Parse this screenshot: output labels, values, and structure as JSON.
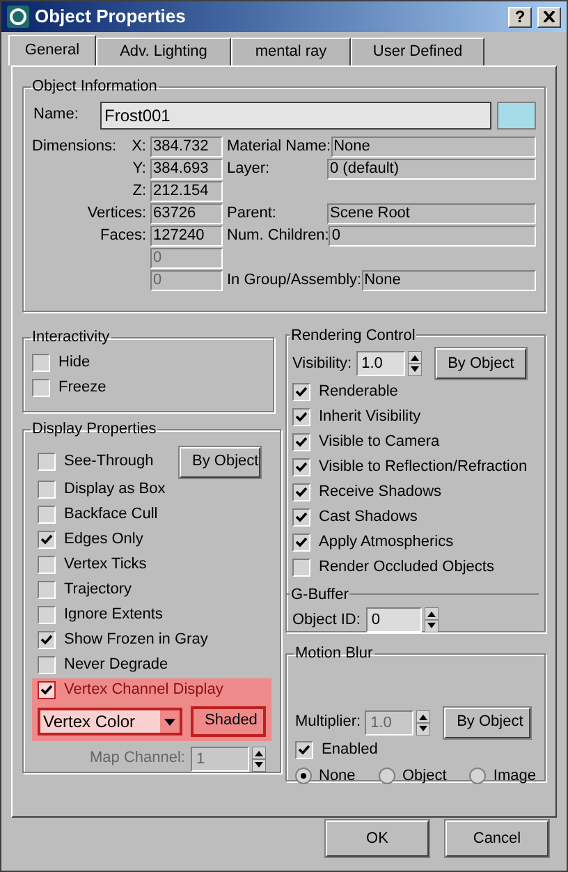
{
  "window": {
    "title": "Object Properties",
    "help_button": "?"
  },
  "tabs": [
    {
      "label": "General",
      "selected": true
    },
    {
      "label": "Adv. Lighting",
      "selected": false
    },
    {
      "label": "mental ray",
      "selected": false
    },
    {
      "label": "User Defined",
      "selected": false
    }
  ],
  "object_information": {
    "title": "Object Information",
    "name_label": "Name:",
    "name_value": "Frost001",
    "color": "#a6dbe8",
    "dimensions_label": "Dimensions:",
    "rows": [
      {
        "label": "X:",
        "value": "384.732",
        "disabled": false,
        "right": {
          "label": "Material Name:",
          "value": "None"
        }
      },
      {
        "label": "Y:",
        "value": "384.693",
        "disabled": false,
        "right": {
          "label": "Layer:",
          "value": "0 (default)"
        }
      },
      {
        "label": "Z:",
        "value": "212.154",
        "disabled": false
      },
      {
        "label": "Vertices:",
        "value": "63726",
        "disabled": false,
        "right": {
          "label": "Parent:",
          "value": "Scene Root"
        }
      },
      {
        "label": "Faces:",
        "value": "127240",
        "disabled": false,
        "right": {
          "label": "Num. Children:",
          "value": "0"
        }
      },
      {
        "value": "0",
        "disabled": true
      },
      {
        "value": "0",
        "disabled": true,
        "right": {
          "label": "In Group/Assembly:",
          "value": "None"
        }
      }
    ]
  },
  "interactivity": {
    "title": "Interactivity",
    "items": [
      {
        "label": "Hide",
        "checked": false
      },
      {
        "label": "Freeze",
        "checked": false
      }
    ]
  },
  "display_properties": {
    "title": "Display Properties",
    "by_object_button": "By Object",
    "items": [
      {
        "label": "See-Through",
        "checked": false,
        "highlighted": false
      },
      {
        "label": "Display as Box",
        "checked": false,
        "highlighted": false
      },
      {
        "label": "Backface Cull",
        "checked": false,
        "highlighted": false
      },
      {
        "label": "Edges Only",
        "checked": true,
        "highlighted": false
      },
      {
        "label": "Vertex Ticks",
        "checked": false,
        "highlighted": false
      },
      {
        "label": "Trajectory",
        "checked": false,
        "highlighted": false
      },
      {
        "label": "Ignore Extents",
        "checked": false,
        "highlighted": false
      },
      {
        "label": "Show Frozen in Gray",
        "checked": true,
        "highlighted": false
      },
      {
        "label": "Never Degrade",
        "checked": false,
        "highlighted": false
      },
      {
        "label": "Vertex Channel Display",
        "checked": true,
        "highlighted": true
      }
    ],
    "channel_dropdown": {
      "value": "Vertex Color",
      "highlighted": true
    },
    "shaded_button": {
      "label": "Shaded",
      "highlighted": true
    },
    "map_channel": {
      "label": "Map Channel:",
      "value": "1",
      "disabled": true
    }
  },
  "rendering_control": {
    "title": "Rendering Control",
    "visibility_label": "Visibility:",
    "visibility_value": "1.0",
    "by_object_button": "By Object",
    "items": [
      {
        "label": "Renderable",
        "checked": true
      },
      {
        "label": "Inherit Visibility",
        "checked": true
      },
      {
        "label": "Visible to Camera",
        "checked": true
      },
      {
        "label": "Visible to Reflection/Refraction",
        "checked": true
      },
      {
        "label": "Receive Shadows",
        "checked": true
      },
      {
        "label": "Cast Shadows",
        "checked": true
      },
      {
        "label": "Apply Atmospherics",
        "checked": true
      },
      {
        "label": "Render Occluded Objects",
        "checked": false
      }
    ]
  },
  "g_buffer": {
    "title": "G-Buffer",
    "object_id_label": "Object ID:",
    "object_id_value": "0"
  },
  "motion_blur": {
    "title": "Motion Blur",
    "multiplier_label": "Multiplier:",
    "multiplier_value": "1.0",
    "multiplier_disabled": true,
    "by_object_button": "By Object",
    "enabled": {
      "label": "Enabled",
      "checked": true
    },
    "types": [
      {
        "label": "None",
        "selected": true
      },
      {
        "label": "Object",
        "selected": false
      },
      {
        "label": "Image",
        "selected": false
      }
    ]
  },
  "buttons": [
    {
      "label": "OK"
    },
    {
      "label": "Cancel"
    }
  ]
}
